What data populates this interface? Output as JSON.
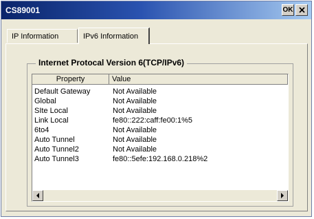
{
  "window": {
    "title": "CS89001",
    "ok_label": "OK",
    "close_icon": "close-icon"
  },
  "tabs": [
    {
      "label": "IP Information",
      "selected": false
    },
    {
      "label": "IPv6 Information",
      "selected": true
    }
  ],
  "group": {
    "title": "Internet Protocal Version 6(TCP/IPv6)"
  },
  "table": {
    "headers": {
      "property": "Property",
      "value": "Value"
    },
    "rows": [
      {
        "property": "Default Gateway",
        "value": "Not Available"
      },
      {
        "property": "Global",
        "value": "Not Available"
      },
      {
        "property": "SIte Local",
        "value": "Not Available"
      },
      {
        "property": "Link Local",
        "value": "fe80::222:caff:fe00:1%5"
      },
      {
        "property": "6to4",
        "value": "Not Available"
      },
      {
        "property": "Auto Tunnel",
        "value": "Not Available"
      },
      {
        "property": "Auto Tunnel2",
        "value": "Not Available"
      },
      {
        "property": "Auto Tunnel3",
        "value": "fe80::5efe:192.168.0.218%2"
      }
    ]
  },
  "colors": {
    "titlebar_start": "#0a246a",
    "titlebar_end": "#a6caf0",
    "dialog_bg": "#ece9d8"
  }
}
